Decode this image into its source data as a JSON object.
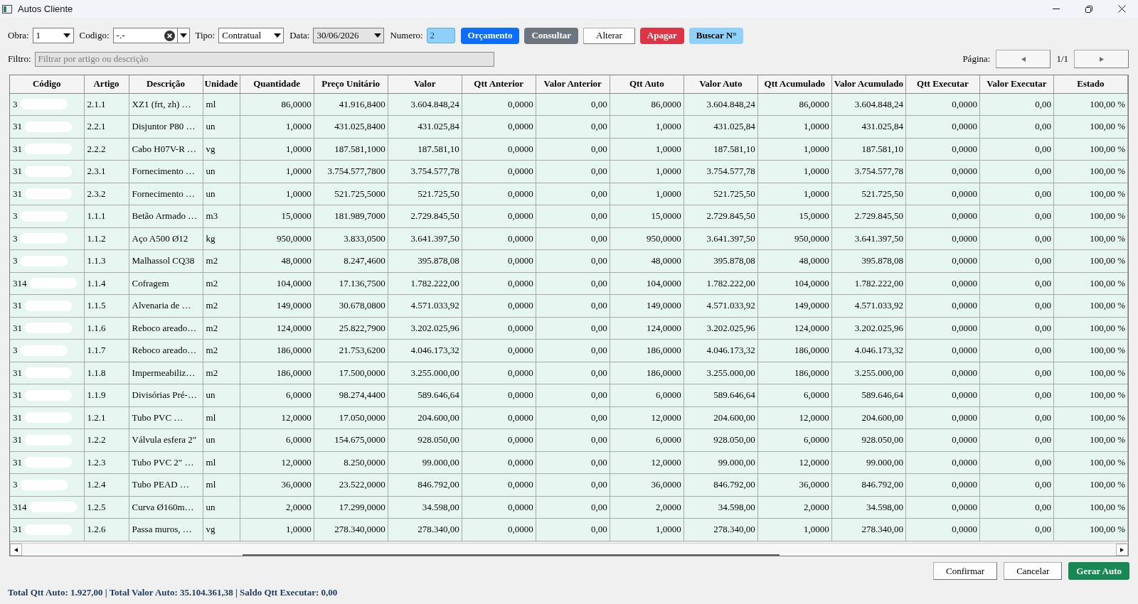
{
  "window": {
    "title": "Autos Cliente"
  },
  "toolbar": {
    "fields": [
      {
        "kind": "select",
        "label": "Obra:",
        "value": "1"
      },
      {
        "kind": "combo",
        "label": "Codigo:",
        "value": "-.-"
      },
      {
        "kind": "select",
        "label": "Tipo:",
        "value": "Contratual"
      },
      {
        "kind": "date",
        "label": "Data:",
        "value": "30/06/2026"
      },
      {
        "kind": "number",
        "label": "Numero:",
        "value": "2"
      }
    ],
    "buttons": [
      {
        "label": "Orçamento",
        "kind": "primary"
      },
      {
        "label": "Consultar",
        "kind": "secondary"
      },
      {
        "label": "Alterar",
        "kind": "plain"
      },
      {
        "label": "Apagar",
        "kind": "danger"
      },
      {
        "label": "Buscar N°",
        "kind": "info"
      }
    ]
  },
  "filter": {
    "label": "Filtro:",
    "placeholder": "Filtrar por artigo ou descrição"
  },
  "pagination": {
    "label": "Página:",
    "page": "1/1"
  },
  "table": {
    "columns": [
      {
        "title": "Código",
        "kind": "text"
      },
      {
        "title": "Artigo",
        "kind": "text"
      },
      {
        "title": "Descrição",
        "kind": "text"
      },
      {
        "title": "Unidade",
        "kind": "text"
      },
      {
        "title": "Quantidade",
        "kind": "number"
      },
      {
        "title": "Preço Unitário",
        "kind": "number"
      },
      {
        "title": "Valor",
        "kind": "number"
      },
      {
        "title": "Qtt Anterior",
        "kind": "number"
      },
      {
        "title": "Valor Anterior",
        "kind": "number"
      },
      {
        "title": "Qtt Auto",
        "kind": "number"
      },
      {
        "title": "Valor Auto",
        "kind": "number"
      },
      {
        "title": "Qtt Acumulado",
        "kind": "number"
      },
      {
        "title": "Valor Acumulado",
        "kind": "number"
      },
      {
        "title": "Qtt Executar",
        "kind": "number"
      },
      {
        "title": "Valor Executar",
        "kind": "number"
      },
      {
        "title": "Estado",
        "kind": "number"
      }
    ],
    "rows": [
      {
        "redacted": true,
        "cells": [
          "3",
          "2.1.1",
          "XZ1 (frt, zh) …",
          "ml",
          "86,0000",
          "41.916,8400",
          "3.604.848,24",
          "0,0000",
          "0,00",
          "86,0000",
          "3.604.848,24",
          "86,0000",
          "3.604.848,24",
          "0,0000",
          "0,00",
          "100,00 %"
        ]
      },
      {
        "redacted": true,
        "cells": [
          "31",
          "2.2.1",
          "Disjuntor P80 …",
          "un",
          "1,0000",
          "431.025,8400",
          "431.025,84",
          "0,0000",
          "0,00",
          "1,0000",
          "431.025,84",
          "1,0000",
          "431.025,84",
          "0,0000",
          "0,00",
          "100,00 %"
        ]
      },
      {
        "redacted": true,
        "cells": [
          "31",
          "2.2.2",
          "Cabo H07V-R …",
          "vg",
          "1,0000",
          "187.581,1000",
          "187.581,10",
          "0,0000",
          "0,00",
          "1,0000",
          "187.581,10",
          "1,0000",
          "187.581,10",
          "0,0000",
          "0,00",
          "100,00 %"
        ]
      },
      {
        "redacted": true,
        "cells": [
          "31",
          "2.3.1",
          "Fornecimento …",
          "un",
          "1,0000",
          "3.754.577,7800",
          "3.754.577,78",
          "0,0000",
          "0,00",
          "1,0000",
          "3.754.577,78",
          "1,0000",
          "3.754.577,78",
          "0,0000",
          "0,00",
          "100,00 %"
        ]
      },
      {
        "redacted": true,
        "cells": [
          "31",
          "2.3.2",
          "Fornecimento …",
          "un",
          "1,0000",
          "521.725,5000",
          "521.725,50",
          "0,0000",
          "0,00",
          "1,0000",
          "521.725,50",
          "1,0000",
          "521.725,50",
          "0,0000",
          "0,00",
          "100,00 %"
        ]
      },
      {
        "redacted": true,
        "cells": [
          "3",
          "1.1.1",
          "Betão Armado …",
          "m3",
          "15,0000",
          "181.989,7000",
          "2.729.845,50",
          "0,0000",
          "0,00",
          "15,0000",
          "2.729.845,50",
          "15,0000",
          "2.729.845,50",
          "0,0000",
          "0,00",
          "100,00 %"
        ]
      },
      {
        "redacted": true,
        "cells": [
          "3",
          "1.1.2",
          "Aço A500 Ø12",
          "kg",
          "950,0000",
          "3.833,0500",
          "3.641.397,50",
          "0,0000",
          "0,00",
          "950,0000",
          "3.641.397,50",
          "950,0000",
          "3.641.397,50",
          "0,0000",
          "0,00",
          "100,00 %"
        ]
      },
      {
        "redacted": true,
        "cells": [
          "3",
          "1.1.3",
          "Malhassol CQ38",
          "m2",
          "48,0000",
          "8.247,4600",
          "395.878,08",
          "0,0000",
          "0,00",
          "48,0000",
          "395.878,08",
          "48,0000",
          "395.878,08",
          "0,0000",
          "0,00",
          "100,00 %"
        ]
      },
      {
        "redacted": true,
        "cells": [
          "314",
          "1.1.4",
          "Cofragem",
          "m2",
          "104,0000",
          "17.136,7500",
          "1.782.222,00",
          "0,0000",
          "0,00",
          "104,0000",
          "1.782.222,00",
          "104,0000",
          "1.782.222,00",
          "0,0000",
          "0,00",
          "100,00 %"
        ]
      },
      {
        "redacted": true,
        "cells": [
          "31",
          "1.1.5",
          "Alvenaria de …",
          "m2",
          "149,0000",
          "30.678,0800",
          "4.571.033,92",
          "0,0000",
          "0,00",
          "149,0000",
          "4.571.033,92",
          "149,0000",
          "4.571.033,92",
          "0,0000",
          "0,00",
          "100,00 %"
        ]
      },
      {
        "redacted": true,
        "cells": [
          "31",
          "1.1.6",
          "Reboco areado…",
          "m2",
          "124,0000",
          "25.822,7900",
          "3.202.025,96",
          "0,0000",
          "0,00",
          "124,0000",
          "3.202.025,96",
          "124,0000",
          "3.202.025,96",
          "0,0000",
          "0,00",
          "100,00 %"
        ]
      },
      {
        "redacted": true,
        "cells": [
          "3",
          "1.1.7",
          "Reboco areado…",
          "m2",
          "186,0000",
          "21.753,6200",
          "4.046.173,32",
          "0,0000",
          "0,00",
          "186,0000",
          "4.046.173,32",
          "186,0000",
          "4.046.173,32",
          "0,0000",
          "0,00",
          "100,00 %"
        ]
      },
      {
        "redacted": true,
        "cells": [
          "31",
          "1.1.8",
          "Impermeabiliz…",
          "m2",
          "186,0000",
          "17.500,0000",
          "3.255.000,00",
          "0,0000",
          "0,00",
          "186,0000",
          "3.255.000,00",
          "186,0000",
          "3.255.000,00",
          "0,0000",
          "0,00",
          "100,00 %"
        ]
      },
      {
        "redacted": true,
        "cells": [
          "31",
          "1.1.9",
          "Divisórias Pré-…",
          "un",
          "6,0000",
          "98.274,4400",
          "589.646,64",
          "0,0000",
          "0,00",
          "6,0000",
          "589.646,64",
          "6,0000",
          "589.646,64",
          "0,0000",
          "0,00",
          "100,00 %"
        ]
      },
      {
        "redacted": true,
        "cells": [
          "31",
          "1.2.1",
          "Tubo PVC …",
          "ml",
          "12,0000",
          "17.050,0000",
          "204.600,00",
          "0,0000",
          "0,00",
          "12,0000",
          "204.600,00",
          "12,0000",
          "204.600,00",
          "0,0000",
          "0,00",
          "100,00 %"
        ]
      },
      {
        "redacted": true,
        "cells": [
          "31",
          "1.2.2",
          "Válvula esfera 2\"",
          "un",
          "6,0000",
          "154.675,0000",
          "928.050,00",
          "0,0000",
          "0,00",
          "6,0000",
          "928.050,00",
          "6,0000",
          "928.050,00",
          "0,0000",
          "0,00",
          "100,00 %"
        ]
      },
      {
        "redacted": true,
        "cells": [
          "31",
          "1.2.3",
          "Tubo PVC 2\" …",
          "ml",
          "12,0000",
          "8.250,0000",
          "99.000,00",
          "0,0000",
          "0,00",
          "12,0000",
          "99.000,00",
          "12,0000",
          "99.000,00",
          "0,0000",
          "0,00",
          "100,00 %"
        ]
      },
      {
        "redacted": true,
        "cells": [
          "3",
          "1.2.4",
          "Tubo PEAD …",
          "ml",
          "36,0000",
          "23.522,0000",
          "846.792,00",
          "0,0000",
          "0,00",
          "36,0000",
          "846.792,00",
          "36,0000",
          "846.792,00",
          "0,0000",
          "0,00",
          "100,00 %"
        ]
      },
      {
        "redacted": true,
        "cells": [
          "314",
          "1.2.5",
          "Curva Ø160m…",
          "un",
          "2,0000",
          "17.299,0000",
          "34.598,00",
          "0,0000",
          "0,00",
          "2,0000",
          "34.598,00",
          "2,0000",
          "34.598,00",
          "0,0000",
          "0,00",
          "100,00 %"
        ]
      },
      {
        "redacted": true,
        "cells": [
          "31",
          "1.2.6",
          "Passa muros, …",
          "vg",
          "1,0000",
          "278.340,0000",
          "278.340,00",
          "0,0000",
          "0,00",
          "1,0000",
          "278.340,00",
          "1,0000",
          "278.340,00",
          "0,0000",
          "0,00",
          "100,00 %"
        ]
      }
    ]
  },
  "actions": [
    {
      "label": "Confirmar",
      "kind": "plain"
    },
    {
      "label": "Cancelar",
      "kind": "plain"
    },
    {
      "label": "Gerar Auto",
      "kind": "success"
    }
  ],
  "status_bar": {
    "text": "Total Qtt Auto: 1.927,00 | Total Valor Auto: 35.104.361,38 | Saldo Qtt Executar: 0,00"
  }
}
